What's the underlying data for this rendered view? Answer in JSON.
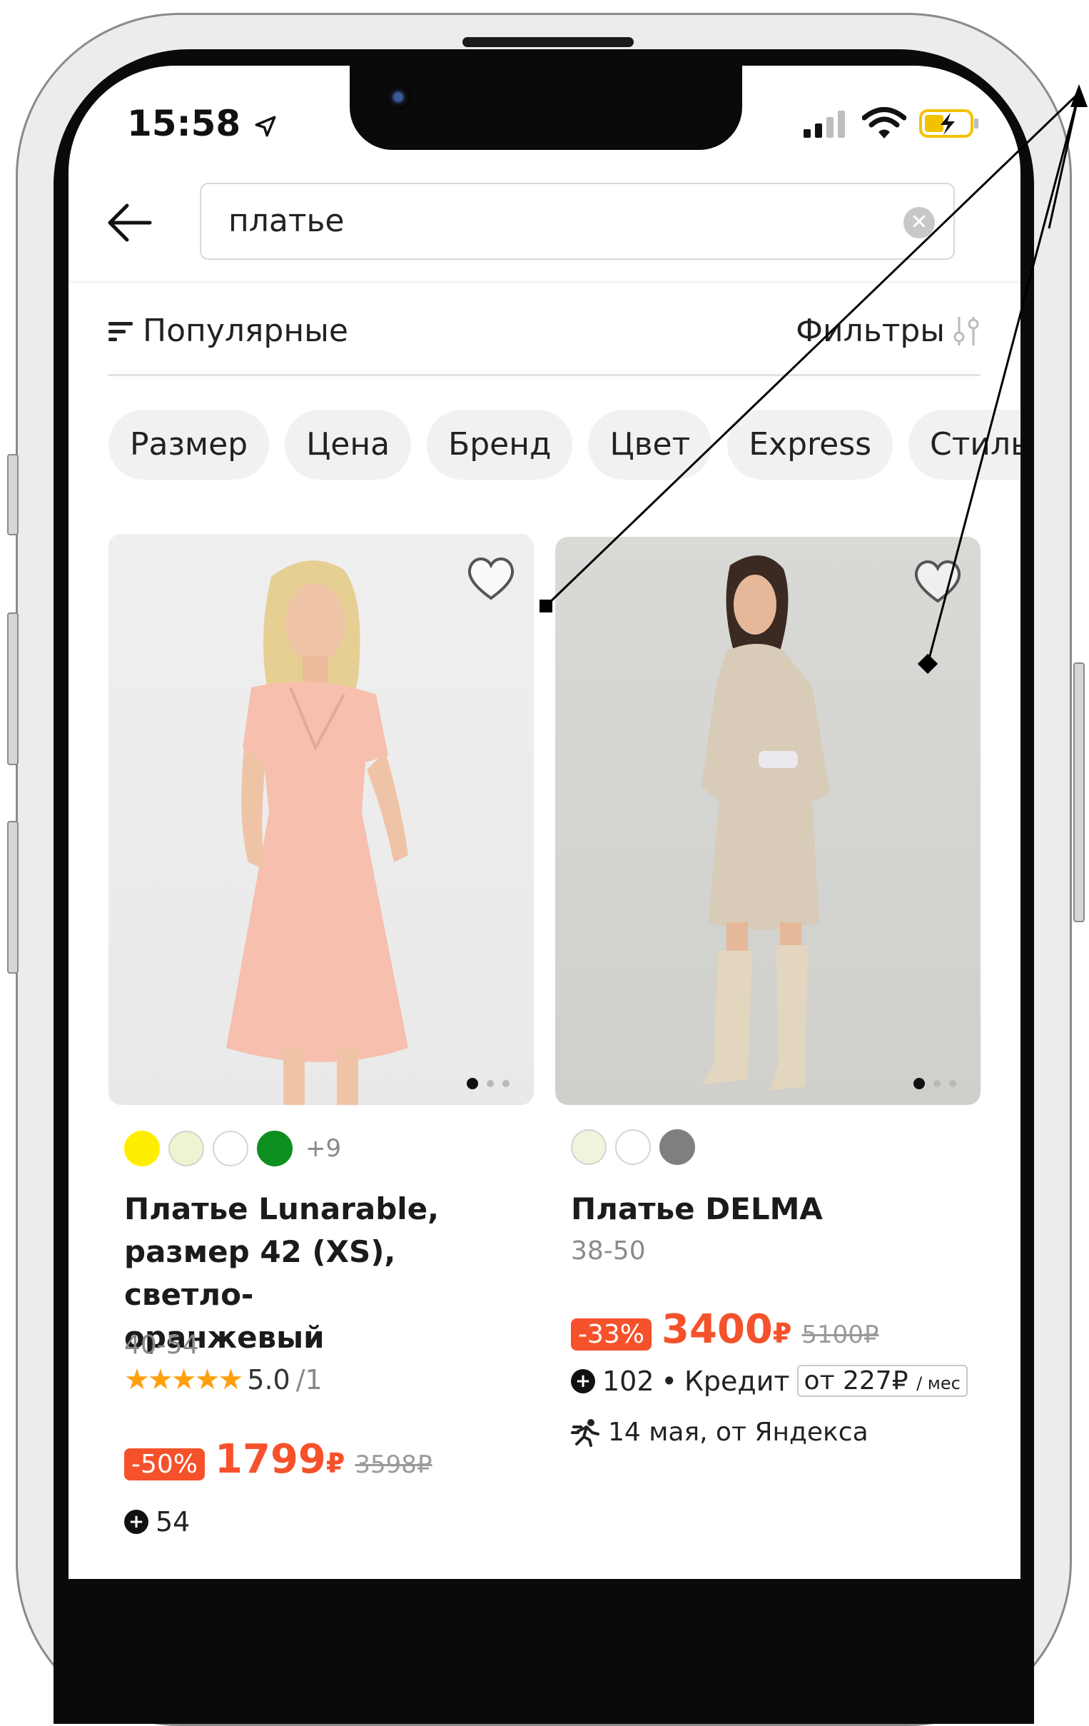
{
  "status_bar": {
    "time": "15:58",
    "location_icon": "location-arrow-icon",
    "signal_icon": "cellular-signal-icon",
    "wifi_icon": "wifi-icon",
    "battery_icon": "battery-charging-icon"
  },
  "search": {
    "query": "платье",
    "back_icon": "arrow-left-icon",
    "clear_icon": "clear-icon"
  },
  "toolbar": {
    "sort_label": "Популярные",
    "filters_label": "Фильтры"
  },
  "chips": [
    "Размер",
    "Цена",
    "Бренд",
    "Цвет",
    "Express",
    "Стиль"
  ],
  "products": [
    {
      "swatches": [
        "#ffee00",
        "#eef3d2",
        "#ffffff",
        "#0d8f1f"
      ],
      "more_colors": "+9",
      "title_lines": [
        "Платье Lunarable,",
        "размер 42 (XS), светло-",
        "оранжевый"
      ],
      "sizes": "40-54",
      "stars": "★★★★★",
      "rating_value": "5.0",
      "rating_count": "/1",
      "discount": "-50%",
      "price": "1799",
      "currency": "₽",
      "old_price": "3598₽",
      "bonus": "54"
    },
    {
      "swatches": [
        "#f1f3dc",
        "#ffffff",
        "#7f7f7f"
      ],
      "title_lines": [
        "Платье DELMA"
      ],
      "sizes": "38-50",
      "discount": "-33%",
      "price": "3400",
      "currency": "₽",
      "old_price": "5100₽",
      "bonus": "102",
      "credit_label": "Кредит",
      "credit_value": "от 227₽",
      "credit_unit": "/ мес",
      "delivery": "14 мая, от Яндекса"
    }
  ],
  "colors": {
    "accent": "#f5522b",
    "star": "#ff9f0a",
    "chip_bg": "#f1f1ef"
  }
}
